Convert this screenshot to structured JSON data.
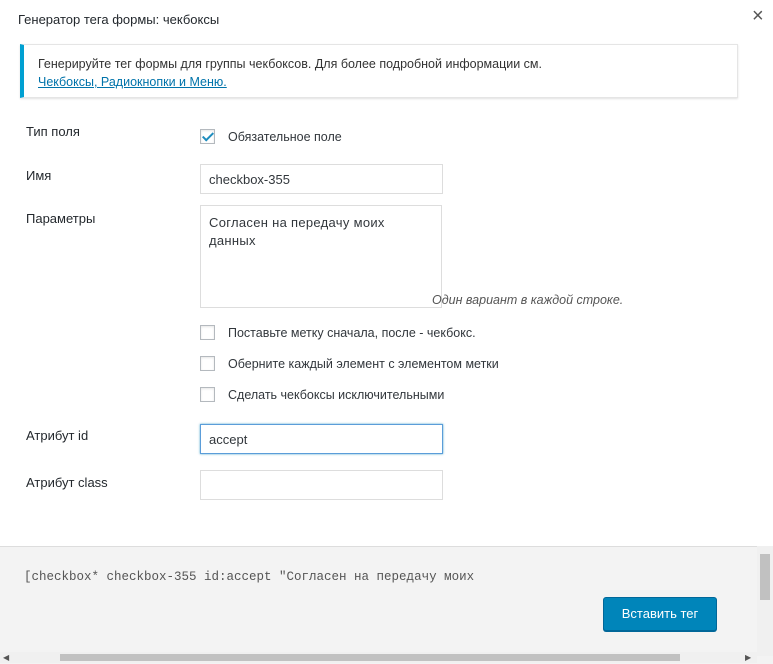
{
  "dialog": {
    "title": "Генератор тега формы: чекбоксы",
    "close_glyph": "×"
  },
  "notice": {
    "text": "Генерируйте тег формы для группы чекбоксов. Для более подробной информации см.",
    "link": "Чекбоксы, Радиокнопки и Меню."
  },
  "form": {
    "field_type_label": "Тип поля",
    "required_label": "Обязательное поле",
    "required_checked": true,
    "name_label": "Имя",
    "name_value": "checkbox-355",
    "options_label": "Параметры",
    "options_value": "Согласен на передачу моих данных",
    "options_hint": "Один вариант в каждой строке.",
    "option_label_first": "Поставьте метку сначала, после - чекбокс.",
    "option_wrap_label": "Оберните каждый элемент с элементом метки",
    "option_exclusive": "Сделать чекбоксы исключительными",
    "id_label": "Атрибут id",
    "id_value": "accept",
    "class_label": "Атрибут class",
    "class_value": ""
  },
  "footer": {
    "tag_code": "[checkbox* checkbox-355 id:accept \"Согласен на передачу моих",
    "insert_button": "Вставить тег"
  },
  "colors": {
    "accent": "#0085ba",
    "notice_border": "#00a0d2",
    "link": "#0073aa"
  }
}
